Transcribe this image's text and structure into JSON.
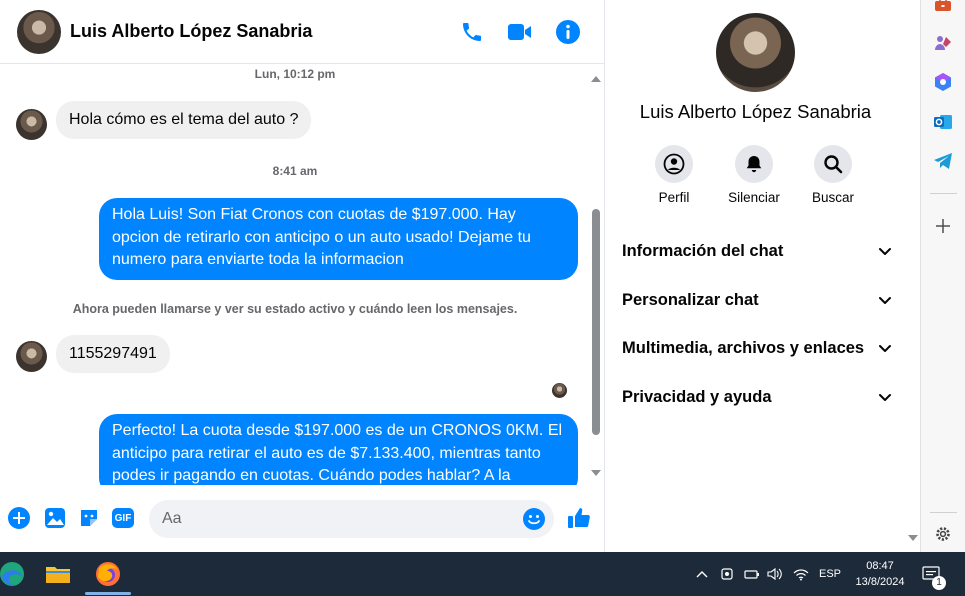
{
  "chat": {
    "contact_name": "Luis Alberto López Sanabria",
    "messages": {
      "ts1": "Lun, 10:12 pm",
      "msg1": "Hola cómo es el tema del auto ?",
      "ts2": "8:41 am",
      "msg2": "Hola Luis! Son Fiat Cronos con cuotas de $197.000. Hay opcion de retirarlo con anticipo o un auto usado! Dejame tu numero para enviarte toda la informacion",
      "system_note": "Ahora pueden llamarse y ver su estado activo y cuándo leen los mensajes.",
      "msg3": "1155297491",
      "msg4": "Perfecto! La cuota desde $197.000 es de un CRONOS 0KM. El anticipo para retirar el auto es de $7.133.400, mientras tanto podes ir pagando en cuotas. Cuándo podes hablar? A la"
    },
    "composer": {
      "placeholder": "Aa",
      "gif_label": "GIF"
    },
    "colors": {
      "accent": "#0084ff",
      "incoming_bubble": "#f0f0f0"
    }
  },
  "info_panel": {
    "name": "Luis Alberto López Sanabria",
    "actions": {
      "profile": "Perfil",
      "mute": "Silenciar",
      "search": "Buscar"
    },
    "sections": [
      "Información del chat",
      "Personalizar chat",
      "Multimedia, archivos y enlaces",
      "Privacidad y ayuda"
    ]
  },
  "taskbar": {
    "language": "ESP",
    "time": "08:47",
    "date": "13/8/2024",
    "notification_count": "1"
  }
}
